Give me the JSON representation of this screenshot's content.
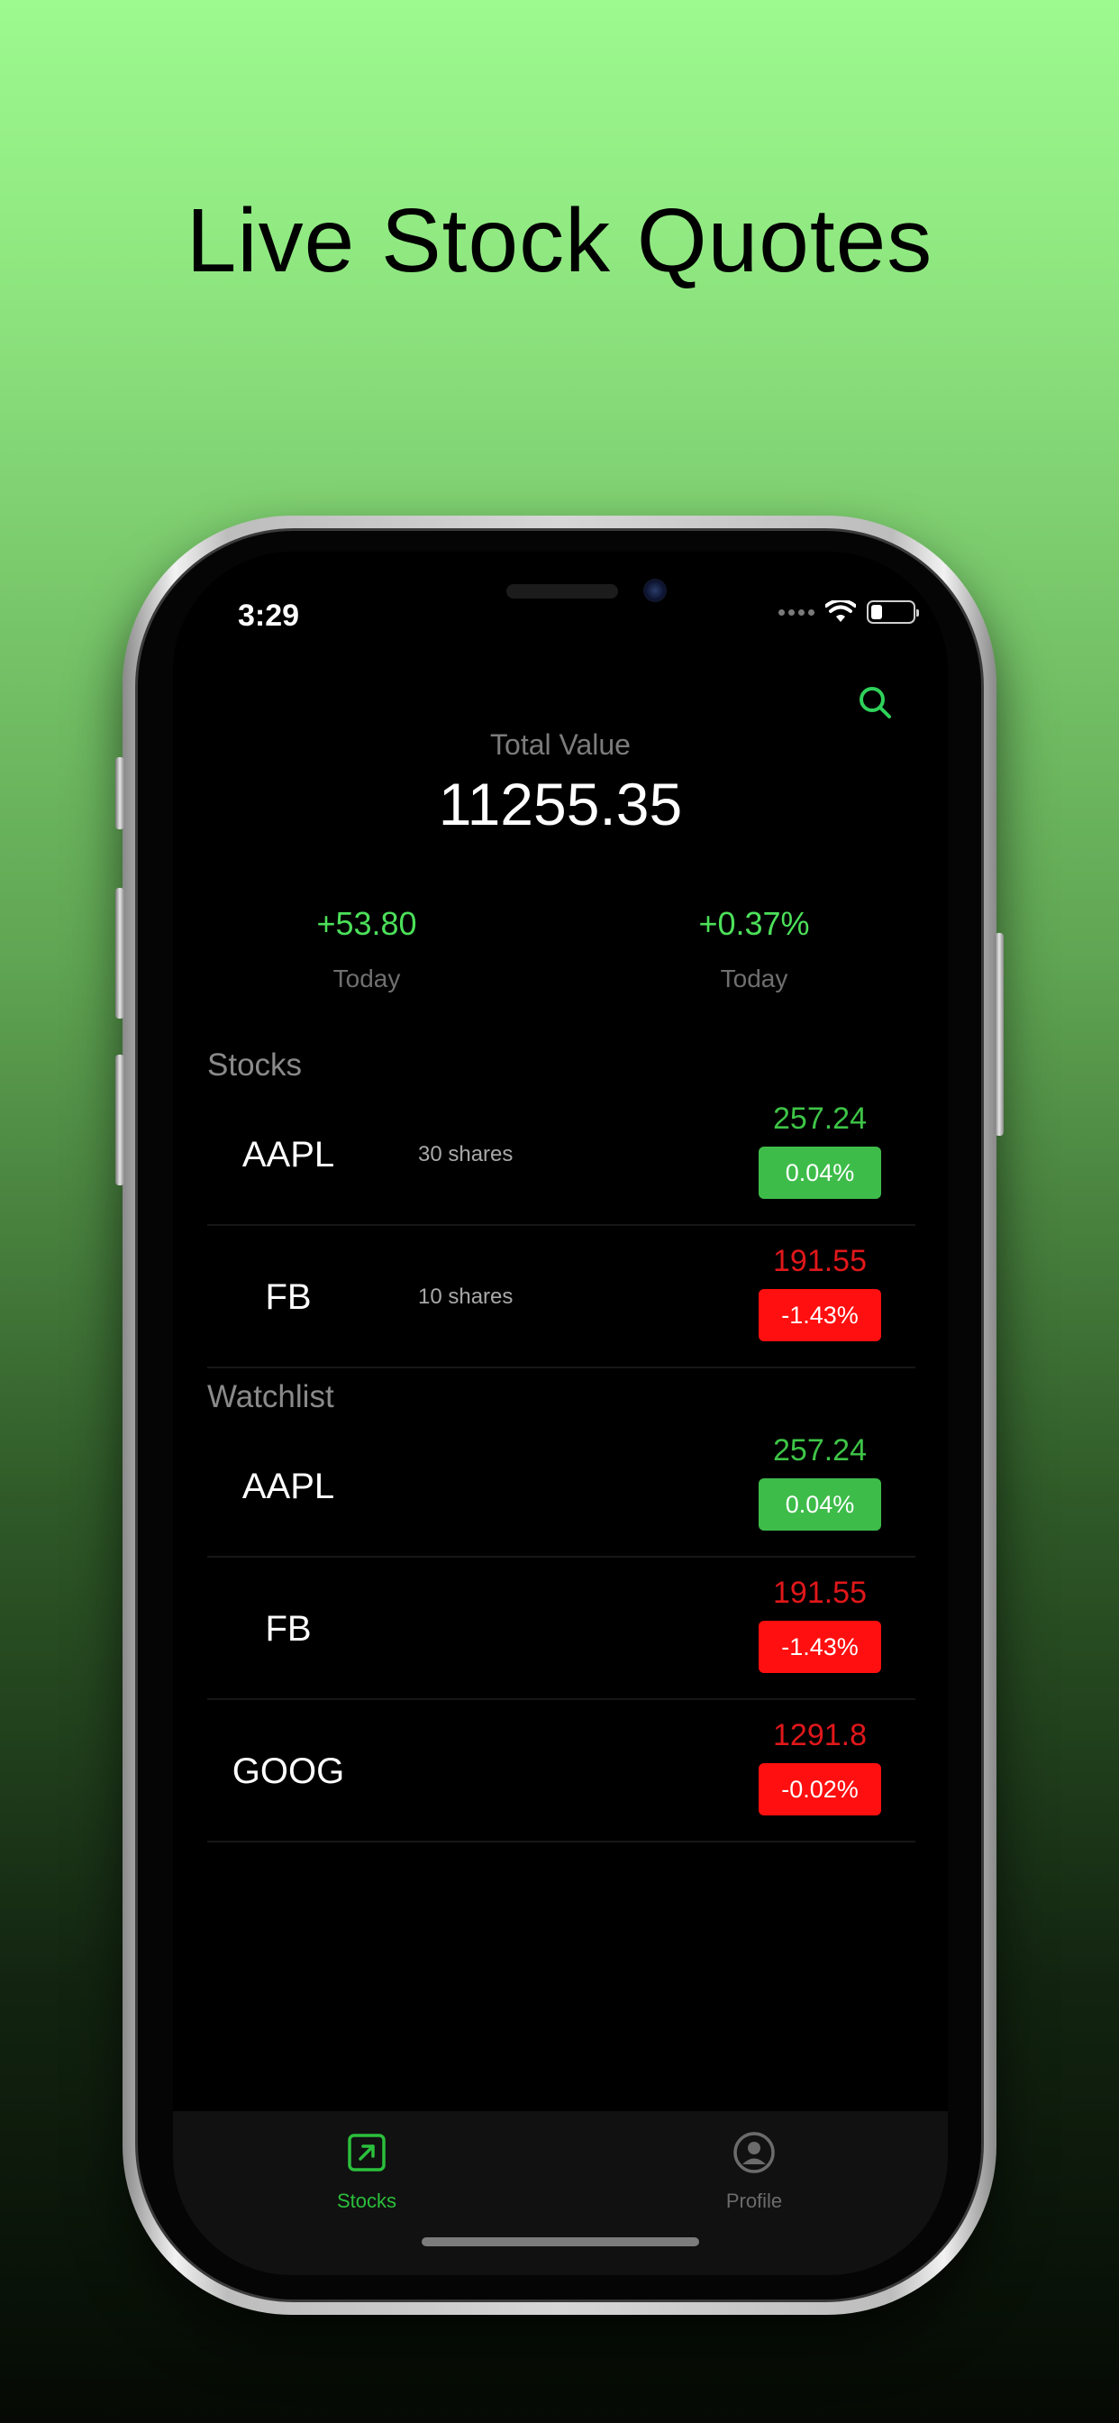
{
  "headline": "Live Stock Quotes",
  "status_bar": {
    "time": "3:29"
  },
  "summary": {
    "total_label": "Total Value",
    "total_value": "11255.35",
    "today_change": "+53.80",
    "today_change_label": "Today",
    "today_percent": "+0.37%",
    "today_percent_label": "Today"
  },
  "stocks": {
    "title": "Stocks",
    "items": [
      {
        "symbol": "AAPL",
        "shares": "30 shares",
        "price": "257.24",
        "change": "0.04%",
        "direction": "up"
      },
      {
        "symbol": "FB",
        "shares": "10 shares",
        "price": "191.55",
        "change": "-1.43%",
        "direction": "down"
      }
    ]
  },
  "watchlist": {
    "title": "Watchlist",
    "items": [
      {
        "symbol": "AAPL",
        "price": "257.24",
        "change": "0.04%",
        "direction": "up"
      },
      {
        "symbol": "FB",
        "price": "191.55",
        "change": "-1.43%",
        "direction": "down"
      },
      {
        "symbol": "GOOG",
        "price": "1291.8",
        "change": "-0.02%",
        "direction": "down"
      }
    ]
  },
  "tabbar": {
    "items": [
      {
        "label": "Stocks",
        "icon": "arrow-up-right-square-icon",
        "active": true
      },
      {
        "label": "Profile",
        "icon": "person-circle-icon",
        "active": false
      }
    ]
  },
  "colors": {
    "accent_green": "#3ec447",
    "negative_red": "#ff0f0f",
    "background": "#000000"
  }
}
